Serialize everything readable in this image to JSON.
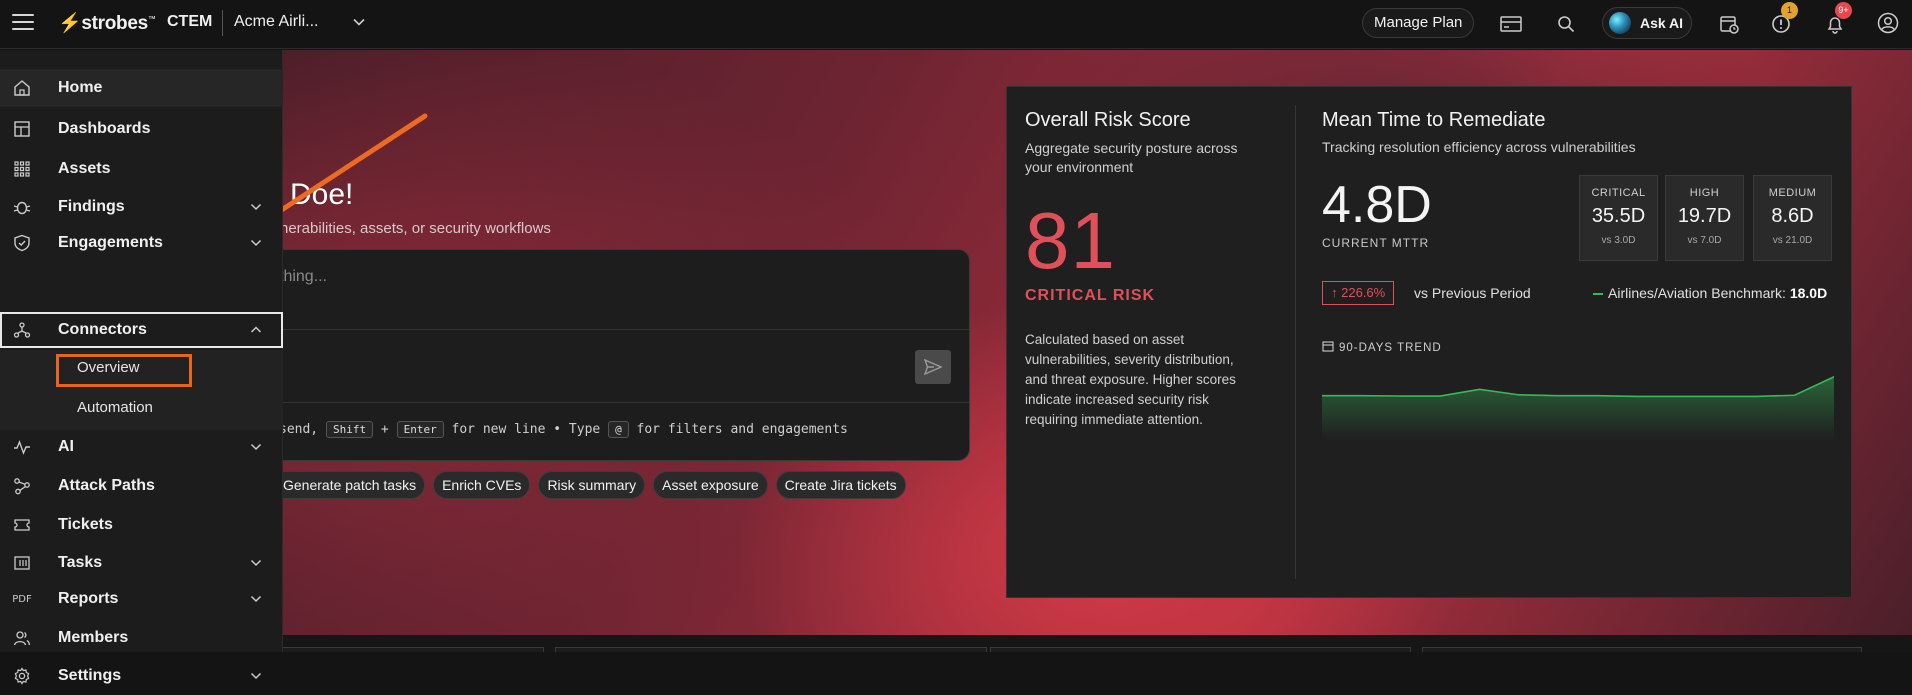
{
  "topbar": {
    "logo": "strobes",
    "product": "CTEM",
    "org": "Acme Airli...",
    "manage_plan": "Manage Plan",
    "ask_ai": "Ask AI",
    "alerts_badge": "1",
    "notifications_badge": "9+"
  },
  "sidebar": {
    "items": [
      {
        "label": "Home"
      },
      {
        "label": "Dashboards"
      },
      {
        "label": "Assets"
      },
      {
        "label": "Findings"
      },
      {
        "label": "Engagements"
      },
      {
        "label": "Connectors"
      },
      {
        "label": "AI"
      },
      {
        "label": "Attack Paths"
      },
      {
        "label": "Tickets"
      },
      {
        "label": "Tasks"
      },
      {
        "label": "Reports"
      },
      {
        "label": "Members"
      },
      {
        "label": "Settings"
      }
    ],
    "connectors_sub": [
      "Overview",
      "Automation"
    ],
    "reports_icon_text": "PDF"
  },
  "hero": {
    "greeting": "Doe!",
    "subtitle": "nerabilities, assets, or security workflows",
    "placeholder": "thing...",
    "hint_pre": "send,",
    "hint_shift": "Shift",
    "hint_plus": "+",
    "hint_enter": "Enter",
    "hint_mid": "for new line • Type",
    "hint_at": "@",
    "hint_post": "for filters and engagements",
    "chips": [
      "Generate patch tasks",
      "Enrich CVEs",
      "Risk summary",
      "Asset exposure",
      "Create Jira tickets"
    ]
  },
  "risk": {
    "title": "Overall Risk Score",
    "desc": "Aggregate security posture across your environment",
    "score": "81",
    "level": "CRITICAL RISK",
    "explanation": "Calculated based on asset vulnerabilities, severity distribution, and threat exposure. Higher scores indicate increased security risk requiring immediate attention."
  },
  "mttr": {
    "title": "Mean Time to Remediate",
    "desc": "Tracking resolution efficiency across vulnerabilities",
    "value": "4.8D",
    "caption": "CURRENT MTTR",
    "severities": [
      {
        "name": "CRITICAL",
        "value": "35.5D",
        "compare": "vs 3.0D"
      },
      {
        "name": "HIGH",
        "value": "19.7D",
        "compare": "vs 7.0D"
      },
      {
        "name": "MEDIUM",
        "value": "8.6D",
        "compare": "vs 21.0D"
      }
    ],
    "delta": "226.6%",
    "vs_previous": "vs Previous Period",
    "benchmark_label": "Airlines/Aviation Benchmark:",
    "benchmark_value": "18.0D",
    "trend_label": "90-DAYS TREND",
    "trend_values": [
      6.2,
      6.2,
      6.1,
      6.1,
      7.8,
      6.4,
      6.2,
      6.2,
      6.0,
      6.0,
      6.0,
      6.0,
      6.3,
      11.0
    ]
  },
  "colors": {
    "accent_red": "#e0505a",
    "highlight_orange": "#e8661c",
    "trend_green": "#38b857"
  }
}
